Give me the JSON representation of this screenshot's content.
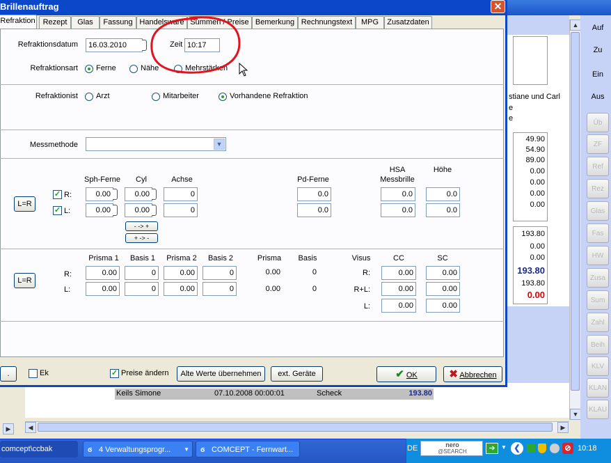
{
  "background": {
    "right_buttons_top": [
      "Auf",
      "Zu",
      "Ein",
      "Aus"
    ],
    "right_buttons_disabled": [
      "Üb",
      "ZF",
      "Ref",
      "Rez",
      "Glas",
      "Fas",
      "HW",
      "Zusa",
      "Sum",
      "Zahl",
      "Beih",
      "KLV",
      "KLAN",
      "KLAU"
    ],
    "customer_text": [
      "stiane und Carl",
      "e",
      "e"
    ],
    "amounts_top": [
      "49.90",
      "54.90",
      "89.00",
      "0.00",
      "0.00",
      "0.00",
      "0.00"
    ],
    "amounts_bottom": [
      "193.80",
      "0.00",
      "0.00",
      "193.80",
      "193.80",
      "0.00"
    ],
    "row": {
      "name": "Keils Simone",
      "date": "07.10.2008 00:00:01",
      "type": "Scheck",
      "amount": "193.80"
    }
  },
  "dialog": {
    "title": "Brillenauftrag",
    "close_glyph": "✕",
    "tabs": [
      "Refraktion",
      "Rezept",
      "Glas",
      "Fassung",
      "Handelsware",
      "Summen / Preise",
      "Bemerkung",
      "Rechnungstext",
      "MPG",
      "Zusatzdaten"
    ],
    "refraktionsdatum_label": "Refraktionsdatum",
    "refraktionsdatum_value": "16.03.2010",
    "zeit_label": "Zeit",
    "zeit_value": "10:17",
    "refraktionsart_label": "Refraktionsart",
    "refraktionsart_options": [
      "Ferne",
      "Nähe",
      "Mehrstärken"
    ],
    "refraktionsart_selected": "Ferne",
    "refraktionist_label": "Refraktionist",
    "refraktionist_options": [
      "Arzt",
      "Mitarbeiter",
      "Vorhandene Refraktion"
    ],
    "refraktionist_selected": "Vorhandene Refraktion",
    "messmethode_label": "Messmethode",
    "messmethode_value": "",
    "lr_button": "L=R",
    "sph_headers": {
      "sph": "Sph-Ferne",
      "cyl": "Cyl",
      "achse": "Achse",
      "pd": "Pd-Ferne",
      "hsa": "HSA",
      "hsa2": "Messbrille",
      "hoehe": "Höhe"
    },
    "row_r_label": "R:",
    "row_l_label": "L:",
    "sph_rows": [
      {
        "sph": "0.00",
        "cyl": "0.00",
        "achse": "0",
        "pd": "0.0",
        "hsa": "0.0",
        "hoehe": "0.0"
      },
      {
        "sph": "0.00",
        "cyl": "0.00",
        "achse": "0",
        "pd": "0.0",
        "hsa": "0.0",
        "hoehe": "0.0"
      }
    ],
    "transpose_buttons": [
      "- -> +",
      "+ -> -"
    ],
    "prisma_headers": {
      "prisma1": "Prisma 1",
      "basis1": "Basis 1",
      "prisma2": "Prisma 2",
      "basis2": "Basis 2",
      "prisma": "Prisma",
      "basis": "Basis",
      "visus": "Visus",
      "cc": "CC",
      "sc": "SC"
    },
    "prisma_rows": [
      {
        "p1": "0.00",
        "b1": "0",
        "p2": "0.00",
        "b2": "0",
        "prisma": "0.00",
        "basis": "0"
      },
      {
        "p1": "0.00",
        "b1": "0",
        "p2": "0.00",
        "b2": "0",
        "prisma": "0.00",
        "basis": "0"
      }
    ],
    "visus_rows": [
      {
        "label": "R:",
        "cc": "0.00",
        "sc": "0.00"
      },
      {
        "label": "R+L:",
        "cc": "0.00",
        "sc": "0.00"
      },
      {
        "label": "L:",
        "cc": "0.00",
        "sc": "0.00"
      }
    ],
    "footer": {
      "dot_button": ".",
      "ek_label": "Ek",
      "preise_aendern_label": "Preise ändern",
      "alte_werte_button": "Alte Werte übernehmen",
      "ext_geraete_button": "ext. Geräte",
      "ok_button": "OK",
      "abbrechen_button": "Abbrechen"
    }
  },
  "taskbar": {
    "item1": "comcept\\ccbak",
    "item2": "4 Verwaltungsprogr...",
    "item3": "COMCEPT - Fernwart...",
    "lang": "DE",
    "nero_line1": "nero",
    "nero_line2": "@SEARCH",
    "clock": "10:18"
  }
}
